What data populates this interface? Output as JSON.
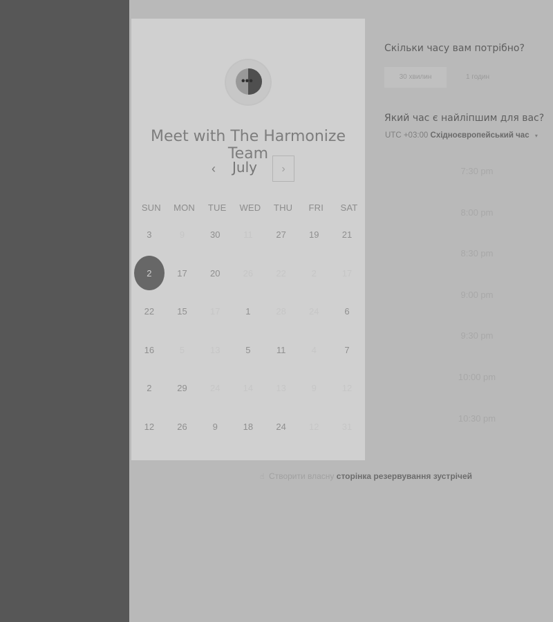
{
  "calendar": {
    "title": "Meet with The Harmonize Team",
    "month": "July",
    "prev_icon": "chevron-left-icon",
    "next_icon": "chevron-right-icon",
    "prev_glyph": "‹",
    "next_glyph": "›",
    "logo_icon": "chat-bubble-icon",
    "logo_dots": "•••",
    "weekdays": [
      "SUN",
      "MON",
      "TUE",
      "WED",
      "THU",
      "FRI",
      "SAT"
    ],
    "weeks": [
      [
        {
          "d": "3",
          "m": false
        },
        {
          "d": "9",
          "m": true
        },
        {
          "d": "30",
          "m": false
        },
        {
          "d": "11",
          "m": true
        },
        {
          "d": "27",
          "m": false
        },
        {
          "d": "19",
          "m": false
        },
        {
          "d": "21",
          "m": false
        }
      ],
      [
        {
          "d": "2",
          "m": false,
          "sel": true
        },
        {
          "d": "17",
          "m": false
        },
        {
          "d": "20",
          "m": false
        },
        {
          "d": "26",
          "m": true
        },
        {
          "d": "22",
          "m": true
        },
        {
          "d": "2",
          "m": true
        },
        {
          "d": "17",
          "m": true
        }
      ],
      [
        {
          "d": "22",
          "m": false
        },
        {
          "d": "15",
          "m": false
        },
        {
          "d": "17",
          "m": true
        },
        {
          "d": "1",
          "m": false
        },
        {
          "d": "28",
          "m": true
        },
        {
          "d": "24",
          "m": true
        },
        {
          "d": "6",
          "m": false
        }
      ],
      [
        {
          "d": "16",
          "m": false
        },
        {
          "d": "5",
          "m": true
        },
        {
          "d": "13",
          "m": true
        },
        {
          "d": "5",
          "m": false
        },
        {
          "d": "11",
          "m": false
        },
        {
          "d": "4",
          "m": true
        },
        {
          "d": "7",
          "m": false
        }
      ],
      [
        {
          "d": "2",
          "m": false
        },
        {
          "d": "29",
          "m": false
        },
        {
          "d": "24",
          "m": true
        },
        {
          "d": "14",
          "m": true
        },
        {
          "d": "13",
          "m": true
        },
        {
          "d": "9",
          "m": true
        },
        {
          "d": "12",
          "m": true
        }
      ],
      [
        {
          "d": "12",
          "m": false
        },
        {
          "d": "26",
          "m": false
        },
        {
          "d": "9",
          "m": false
        },
        {
          "d": "18",
          "m": false
        },
        {
          "d": "24",
          "m": false
        },
        {
          "d": "12",
          "m": true
        },
        {
          "d": "31",
          "m": true
        }
      ]
    ]
  },
  "booking": {
    "duration_question": "Скільки часу вам потрібно?",
    "durations": [
      {
        "label": "30 хвилин",
        "active": true
      },
      {
        "label": "1 годин",
        "active": false
      }
    ],
    "time_question": "Який час є найліпшим для вас?",
    "timezone_offset": "UTC +03:00",
    "timezone_name": "Східноєвропейський час",
    "timezone_caret": "▾",
    "times": [
      "7:30 pm",
      "8:00 pm",
      "8:30 pm",
      "9:00 pm",
      "9:30 pm",
      "10:00 pm",
      "10:30 pm"
    ]
  },
  "footer": {
    "icon": "pointer-hand-icon",
    "icon_glyph": "☝",
    "prefix": "Створити власну",
    "link": "сторінка резервування зустрічей"
  },
  "colors": {
    "sidebar": "#575757",
    "background": "#b9b9b9",
    "card": "#d0d0d0",
    "selected_day": "#676767"
  }
}
